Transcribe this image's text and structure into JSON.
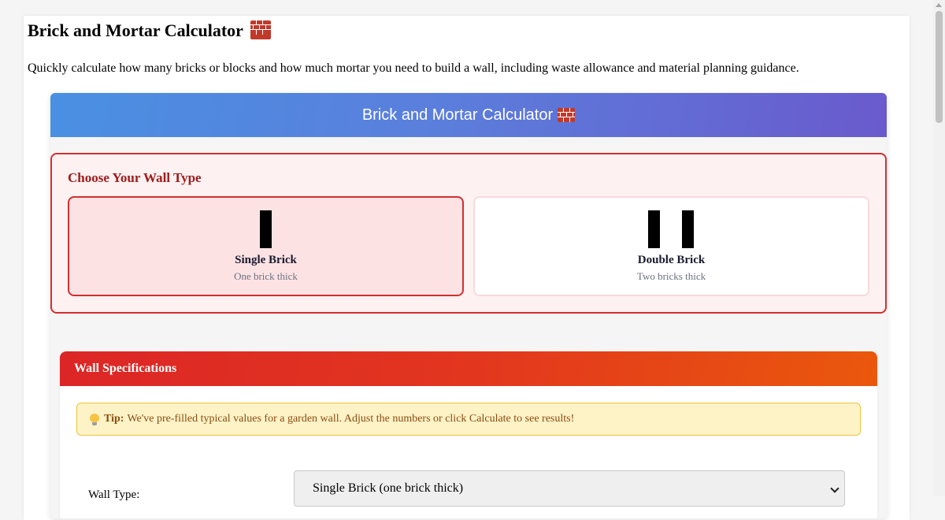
{
  "page": {
    "title": "Brick and Mortar Calculator",
    "intro": "Quickly calculate how many bricks or blocks and how much mortar you need to build a wall, including waste allowance and material planning guidance."
  },
  "calculator": {
    "header_title": "Brick and Mortar Calculator",
    "wall_type_section": {
      "title": "Choose Your Wall Type",
      "options": [
        {
          "name": "Single Brick",
          "description": "One brick thick",
          "selected": true,
          "icon": "single-brick-wall-icon"
        },
        {
          "name": "Double Brick",
          "description": "Two bricks thick",
          "selected": false,
          "icon": "double-brick-wall-icon"
        }
      ]
    },
    "specifications": {
      "title": "Wall Specifications",
      "tip_label": "Tip:",
      "tip_text": "We've pre-filled typical values for a garden wall. Adjust the numbers or click Calculate to see results!",
      "wall_type_label": "Wall Type:",
      "wall_type_value": "Single Brick (one brick thick)"
    }
  },
  "colors": {
    "header_gradient_start": "#4a90e2",
    "header_gradient_end": "#6a5acd",
    "accent_red": "#d32f2f",
    "spec_gradient_start": "#dc2626",
    "spec_gradient_end": "#ea580c",
    "tip_background": "#fef3c7"
  },
  "icons": {
    "title_emoji": "brick-icon",
    "tip_emoji": "light-bulb-icon"
  }
}
